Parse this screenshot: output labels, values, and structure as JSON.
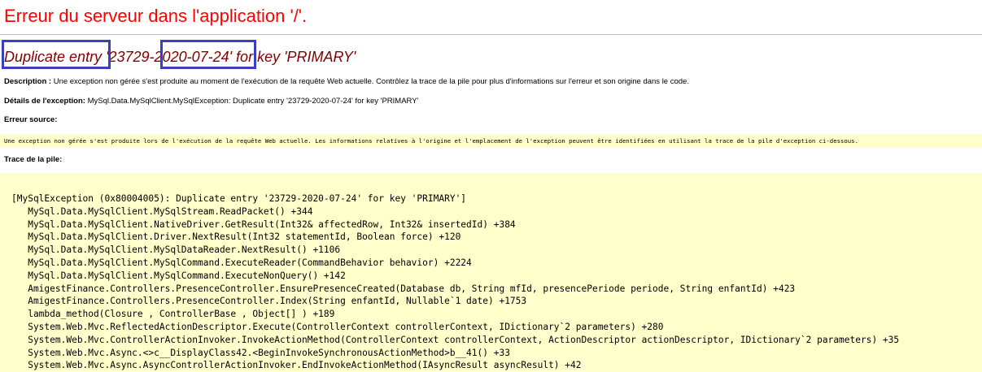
{
  "page": {
    "title": "Erreur du serveur dans l'application '/'.",
    "error_heading": "Duplicate entry '23729-2020-07-24' for key 'PRIMARY'",
    "description_label": "Description :",
    "description_text": " Une exception non gérée s'est produite au moment de l'exécution de la requête Web actuelle. Contrôlez la trace de la pile pour plus d'informations sur l'erreur et son origine dans le code.",
    "details_label": "Détails de l'exception:",
    "details_text": " MySql.Data.MySqlClient.MySqlException: Duplicate entry '23729-2020-07-24' for key 'PRIMARY'",
    "source_label": "Erreur source:",
    "source_text": "Une exception non gérée s'est produite lors de l'exécution de la requête Web actuelle. Les informations relatives à l'origine et l'emplacement de l'exception peuvent être identifiées en utilisant la trace de la pile d'exception ci-dessous.",
    "stack_label": "Trace de la pile:",
    "highlight_color": "#3b3fbf",
    "title_color": "#ff0000",
    "heading_color": "#800000",
    "code_background": "#ffffcc"
  },
  "stack_trace": [
    "[MySqlException (0x80004005): Duplicate entry '23729-2020-07-24' for key 'PRIMARY']",
    "   MySql.Data.MySqlClient.MySqlStream.ReadPacket() +344",
    "   MySql.Data.MySqlClient.NativeDriver.GetResult(Int32& affectedRow, Int32& insertedId) +384",
    "   MySql.Data.MySqlClient.Driver.NextResult(Int32 statementId, Boolean force) +120",
    "   MySql.Data.MySqlClient.MySqlDataReader.NextResult() +1106",
    "   MySql.Data.MySqlClient.MySqlCommand.ExecuteReader(CommandBehavior behavior) +2224",
    "   MySql.Data.MySqlClient.MySqlCommand.ExecuteNonQuery() +142",
    "   AmigestFinance.Controllers.PresenceController.EnsurePresenceCreated(Database db, String mfId, presencePeriode periode, String enfantId) +423",
    "   AmigestFinance.Controllers.PresenceController.Index(String enfantId, Nullable`1 date) +1753",
    "   lambda_method(Closure , ControllerBase , Object[] ) +189",
    "   System.Web.Mvc.ReflectedActionDescriptor.Execute(ControllerContext controllerContext, IDictionary`2 parameters) +280",
    "   System.Web.Mvc.ControllerActionInvoker.InvokeActionMethod(ControllerContext controllerContext, ActionDescriptor actionDescriptor, IDictionary`2 parameters) +35",
    "   System.Web.Mvc.Async.<>c__DisplayClass42.<BeginInvokeSynchronousActionMethod>b__41() +33",
    "   System.Web.Mvc.Async.AsyncControllerActionInvoker.EndInvokeActionMethod(IAsyncResult asyncResult) +42"
  ]
}
